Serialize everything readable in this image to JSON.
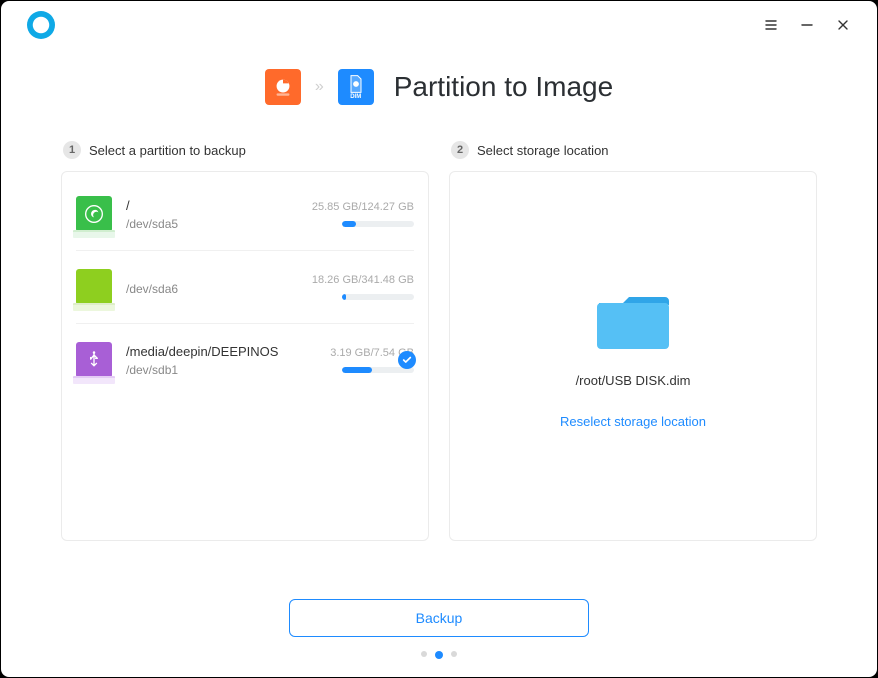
{
  "header": {
    "title": "Partition to Image"
  },
  "steps": {
    "step1": {
      "num": "1",
      "label": "Select a partition to backup"
    },
    "step2": {
      "num": "2",
      "label": "Select storage location"
    }
  },
  "partitions": [
    {
      "mount": "/",
      "device": "/dev/sda5",
      "size": "25.85 GB/124.27 GB",
      "pct": 20,
      "selected": false,
      "kind": "deepin"
    },
    {
      "mount": "",
      "device": "/dev/sda6",
      "size": "18.26 GB/341.48 GB",
      "pct": 5,
      "selected": false,
      "kind": "green"
    },
    {
      "mount": "/media/deepin/DEEPINOS",
      "device": "/dev/sdb1",
      "size": "3.19 GB/7.54 GB",
      "pct": 42,
      "selected": true,
      "kind": "usb"
    }
  ],
  "storage": {
    "path": "/root/USB DISK.dim",
    "reselect": "Reselect storage location"
  },
  "footer": {
    "backup": "Backup"
  }
}
